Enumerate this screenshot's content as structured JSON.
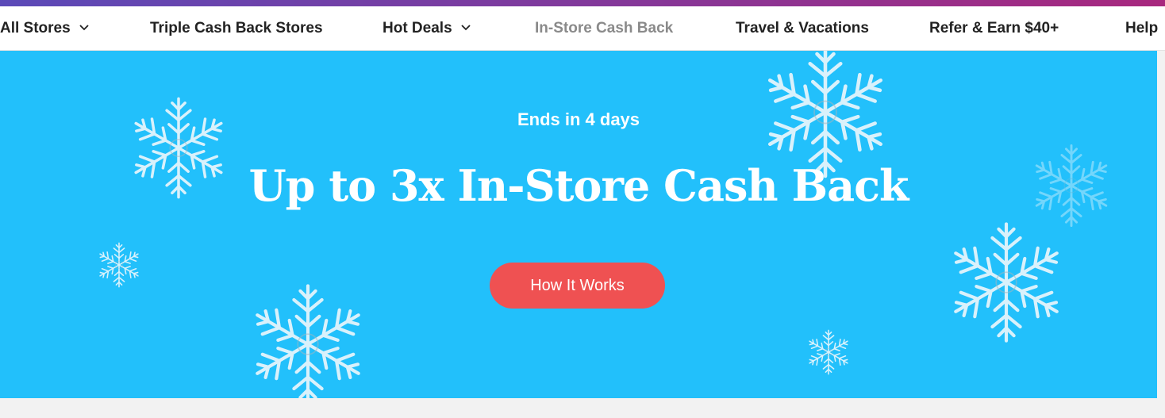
{
  "colors": {
    "gradient_start": "#5b4ab8",
    "gradient_end": "#a8287e",
    "hero_bg": "#22c0fb",
    "cta_bg": "#ef5152",
    "nav_text": "#222222",
    "nav_active_text": "#8a8a8a"
  },
  "nav": {
    "items": [
      {
        "label": "All Stores",
        "has_dropdown": true
      },
      {
        "label": "Triple Cash Back Stores",
        "has_dropdown": false
      },
      {
        "label": "Hot Deals",
        "has_dropdown": true
      },
      {
        "label": "In-Store Cash Back",
        "has_dropdown": false,
        "active": true
      },
      {
        "label": "Travel & Vacations",
        "has_dropdown": false
      },
      {
        "label": "Refer & Earn $40+",
        "has_dropdown": false
      },
      {
        "label": "Help",
        "has_dropdown": false
      }
    ],
    "dropdown_icon": "chevron-down-icon"
  },
  "hero": {
    "countdown": "Ends in 4 days",
    "title": "Up to 3x In-Store Cash Back",
    "cta_label": "How It Works",
    "decoration_icon": "snowflake-icon"
  }
}
